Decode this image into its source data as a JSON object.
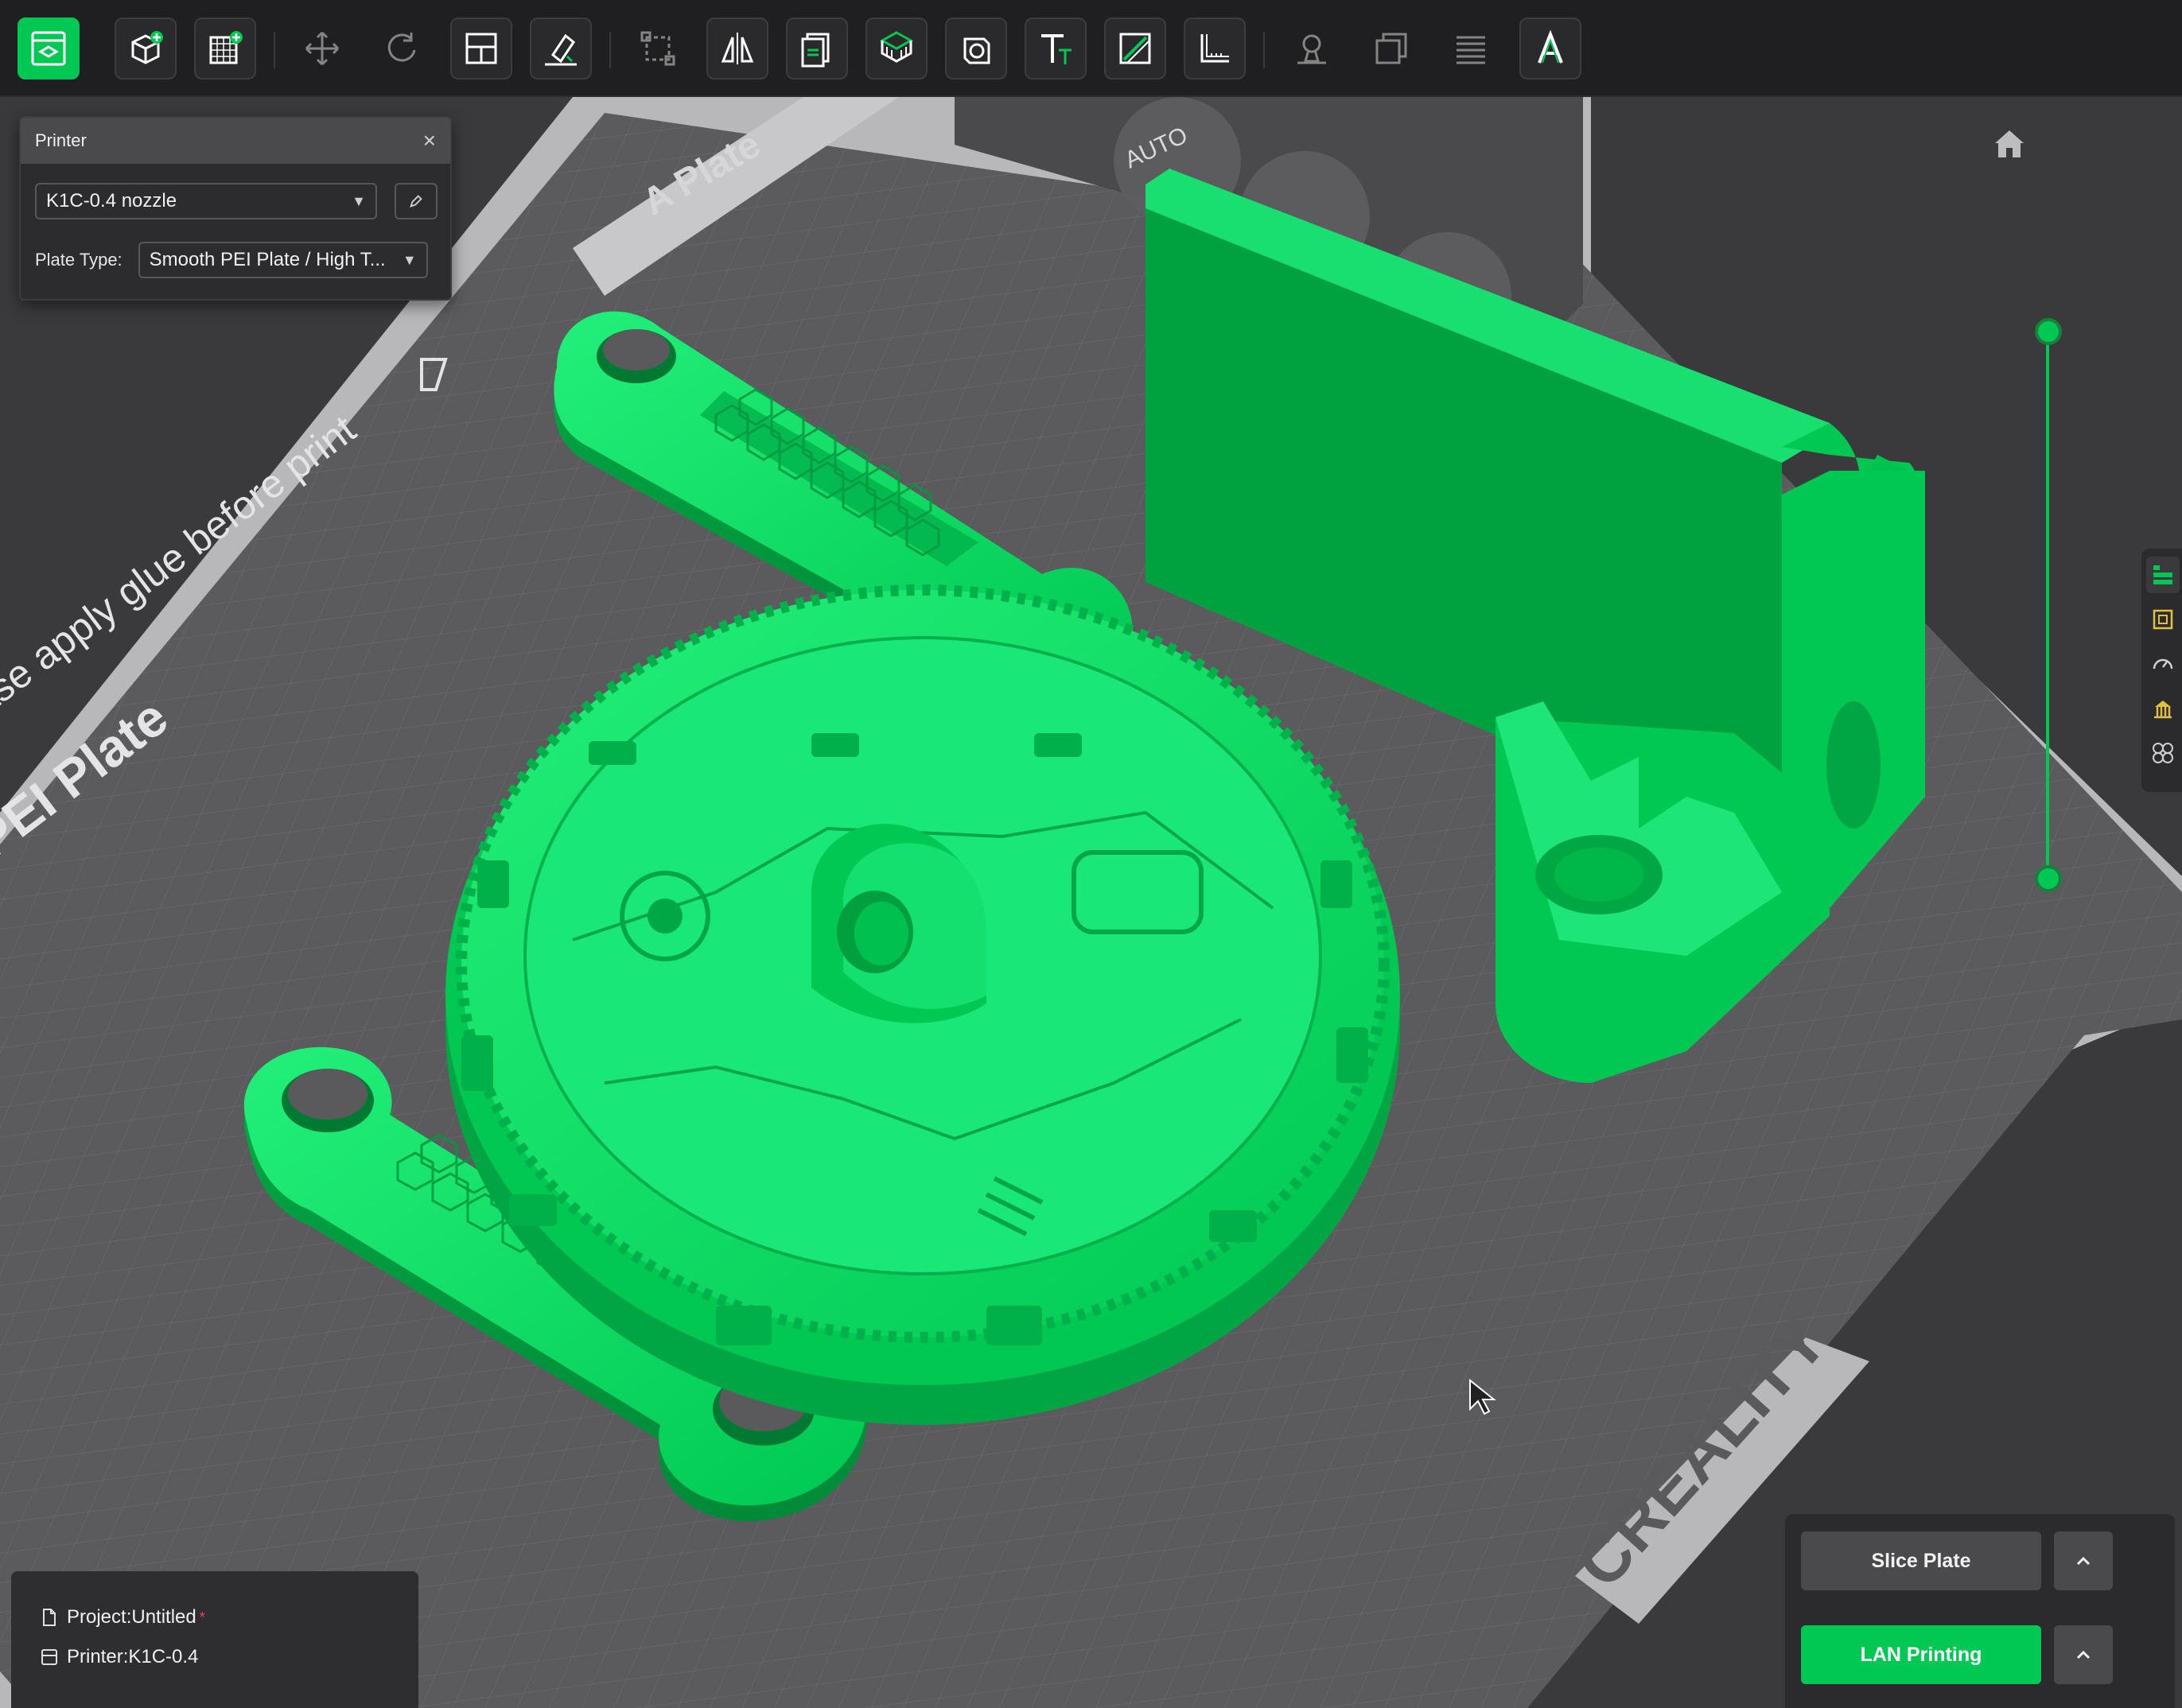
{
  "toolbar": {
    "buttons": [
      {
        "name": "prepare-view-icon"
      },
      {
        "name": "add-object-icon"
      },
      {
        "name": "add-plate-icon"
      },
      {
        "name": "move-icon"
      },
      {
        "name": "rotate-icon"
      },
      {
        "name": "arrange-icon"
      },
      {
        "name": "lay-on-face-icon"
      },
      {
        "name": "scale-icon"
      },
      {
        "name": "mirror-icon"
      },
      {
        "name": "cut-icon"
      },
      {
        "name": "support-paint-icon"
      },
      {
        "name": "hollow-icon"
      },
      {
        "name": "text-icon"
      },
      {
        "name": "seam-paint-icon"
      },
      {
        "name": "measure-icon"
      },
      {
        "name": "brim-ears-icon"
      },
      {
        "name": "assembly-icon"
      },
      {
        "name": "layers-icon"
      },
      {
        "name": "text-emboss-icon"
      }
    ]
  },
  "printer_panel": {
    "title": "Printer",
    "printer_value": "K1C-0.4 nozzle",
    "plate_type_label": "Plate Type:",
    "plate_type_value": "Smooth PEI Plate / High T..."
  },
  "bed": {
    "plate_tab_label": "A Plate",
    "notice_text": "ase apply glue before print",
    "plate_name_text": "PEI Plate",
    "brand_text": "CREALITY",
    "auto_label": "AUTO"
  },
  "project_info": {
    "project_label": "Project:Untitled",
    "modified_mark": "*",
    "printer_label": "Printer:K1C-0.4"
  },
  "actions": {
    "slice_label": "Slice Plate",
    "lan_label": "LAN Printing"
  },
  "colors": {
    "accent": "#00c853",
    "model": "#00e060",
    "bed": "#5a5a5c",
    "background": "#3a3a3c"
  }
}
